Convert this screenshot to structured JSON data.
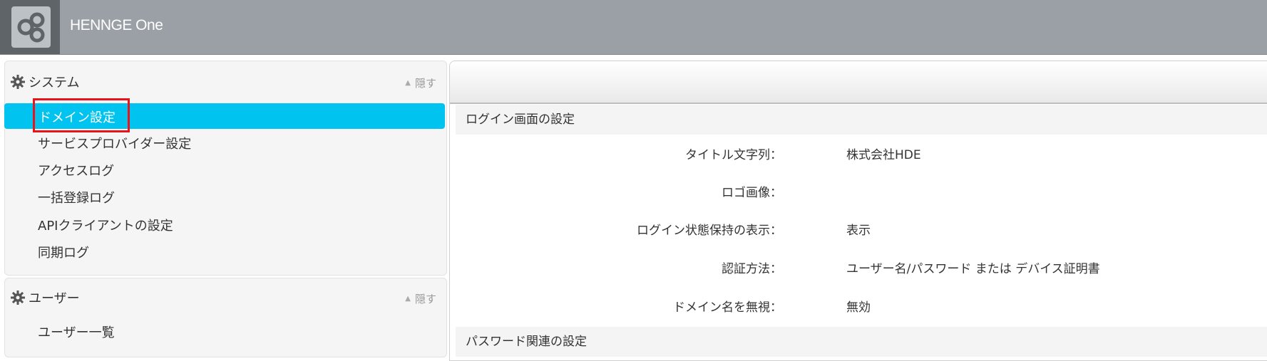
{
  "header": {
    "brand": "HENNGE One"
  },
  "sidebar": {
    "sections": [
      {
        "title": "システム",
        "hide_label": "隠す",
        "items": [
          {
            "label": "ドメイン設定"
          },
          {
            "label": "サービスプロバイダー設定"
          },
          {
            "label": "アクセスログ"
          },
          {
            "label": "一括登録ログ"
          },
          {
            "label": "APIクライアントの設定"
          },
          {
            "label": "同期ログ"
          }
        ]
      },
      {
        "title": "ユーザー",
        "hide_label": "隠す",
        "items": [
          {
            "label": "ユーザー一覧"
          }
        ]
      }
    ]
  },
  "main": {
    "group1": {
      "title": "ログイン画面の設定",
      "rows": [
        {
          "label": "タイトル文字列：",
          "value": "株式会社HDE"
        },
        {
          "label": "ロゴ画像：",
          "value": ""
        },
        {
          "label": "ログイン状態保持の表示：",
          "value": "表示"
        },
        {
          "label": "認証方法：",
          "value": "ユーザー名/パスワード または デバイス証明書"
        },
        {
          "label": "ドメイン名を無視：",
          "value": "無効"
        }
      ]
    },
    "group2": {
      "title": "パスワード関連の設定"
    }
  },
  "colors": {
    "active_item": "#00c4ef",
    "topbar": "#9aa0a5",
    "highlight": "#e8141b"
  }
}
